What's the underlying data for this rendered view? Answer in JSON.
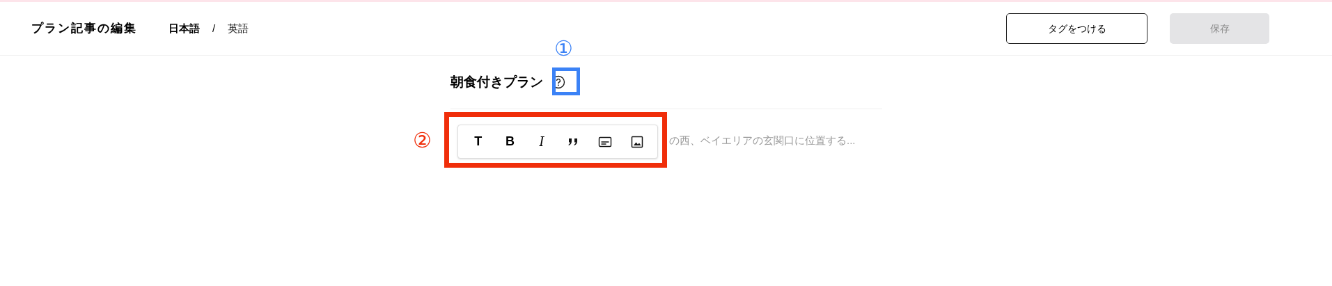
{
  "header": {
    "title": "プラン記事の編集",
    "languages": [
      {
        "label": "日本語",
        "selected": true
      },
      {
        "label": "英語",
        "selected": false
      }
    ],
    "separator": "/",
    "buttons": [
      {
        "label": "タグをつける",
        "kind": "outline"
      },
      {
        "label": "保存",
        "kind": "primary",
        "disabled": true
      }
    ]
  },
  "editor": {
    "heading": "朝食付きプラン",
    "body_end": "の西、ベイエリアの玄関口に位置する...",
    "toolbar": [
      {
        "kind": "text",
        "label": "T"
      },
      {
        "kind": "text",
        "label": "B"
      },
      {
        "kind": "italic",
        "label": "I"
      },
      {
        "kind": "quote"
      },
      {
        "kind": "caption"
      },
      {
        "kind": "image"
      }
    ]
  },
  "annotations": [
    {
      "label": "①",
      "color": "#3b82f6"
    },
    {
      "label": "②",
      "color": "#f02e0a"
    }
  ]
}
